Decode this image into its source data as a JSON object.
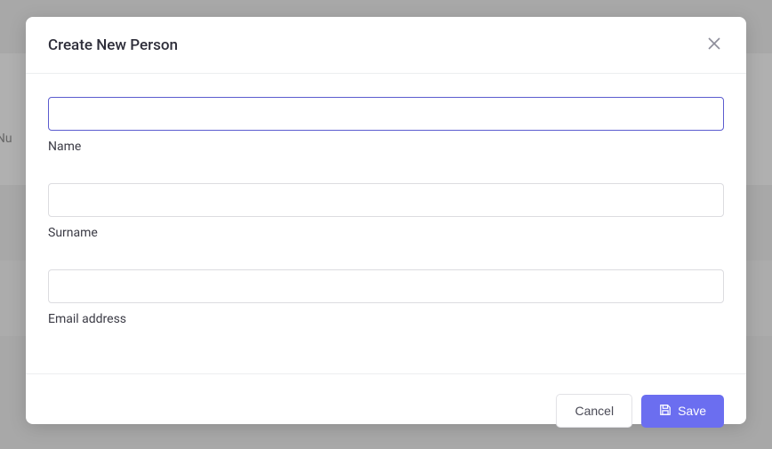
{
  "modal": {
    "title": "Create New Person",
    "fields": {
      "name": {
        "label": "Name",
        "value": ""
      },
      "surname": {
        "label": "Surname",
        "value": ""
      },
      "email": {
        "label": "Email address",
        "value": ""
      }
    },
    "buttons": {
      "cancel": "Cancel",
      "save": "Save"
    }
  },
  "background": {
    "partial_text": "e Nu"
  }
}
